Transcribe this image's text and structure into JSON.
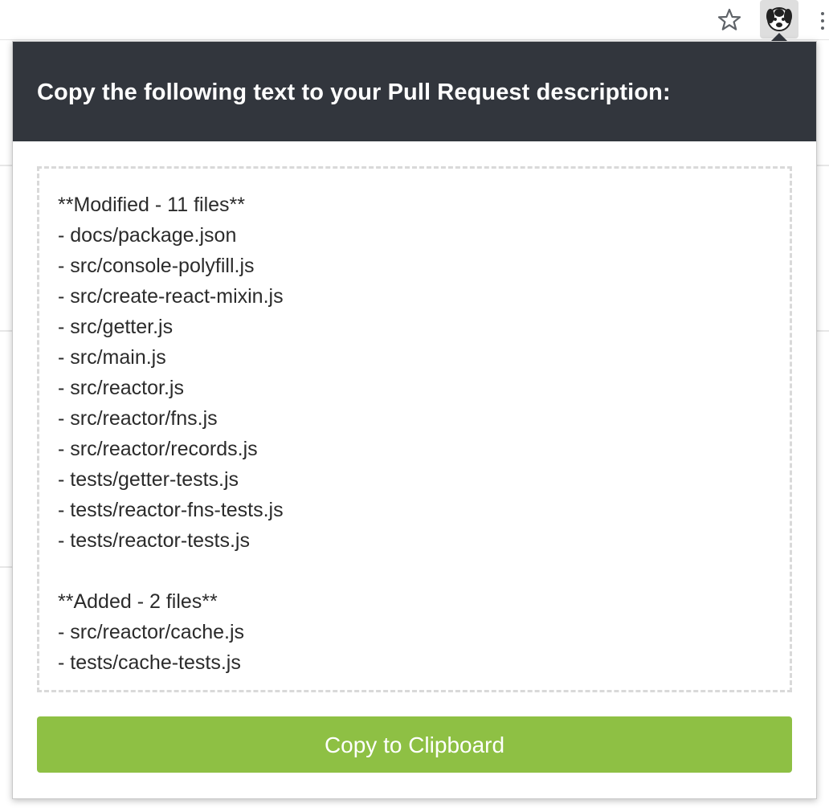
{
  "browser": {
    "bookmark_icon": "star-outline-icon",
    "extension_icon": "dog-face-icon",
    "menu_icon": "three-dots-vertical-icon",
    "close_glyph": "×"
  },
  "popup": {
    "header_title": "Copy the following text to your Pull Request description:",
    "lines": [
      "**Modified - 11 files**",
      "- docs/package.json",
      "- src/console-polyfill.js",
      "- src/create-react-mixin.js",
      "- src/getter.js",
      "- src/main.js",
      "- src/reactor.js",
      "- src/reactor/fns.js",
      "- src/reactor/records.js",
      "- tests/getter-tests.js",
      "- tests/reactor-fns-tests.js",
      "- tests/reactor-tests.js",
      "",
      "**Added - 2 files**",
      "- src/reactor/cache.js",
      "- tests/cache-tests.js"
    ],
    "copy_button_label": "Copy to Clipboard"
  },
  "colors": {
    "header_bg": "#32363d",
    "button_bg": "#8ec044",
    "dashed_border": "#d9d9d9"
  }
}
